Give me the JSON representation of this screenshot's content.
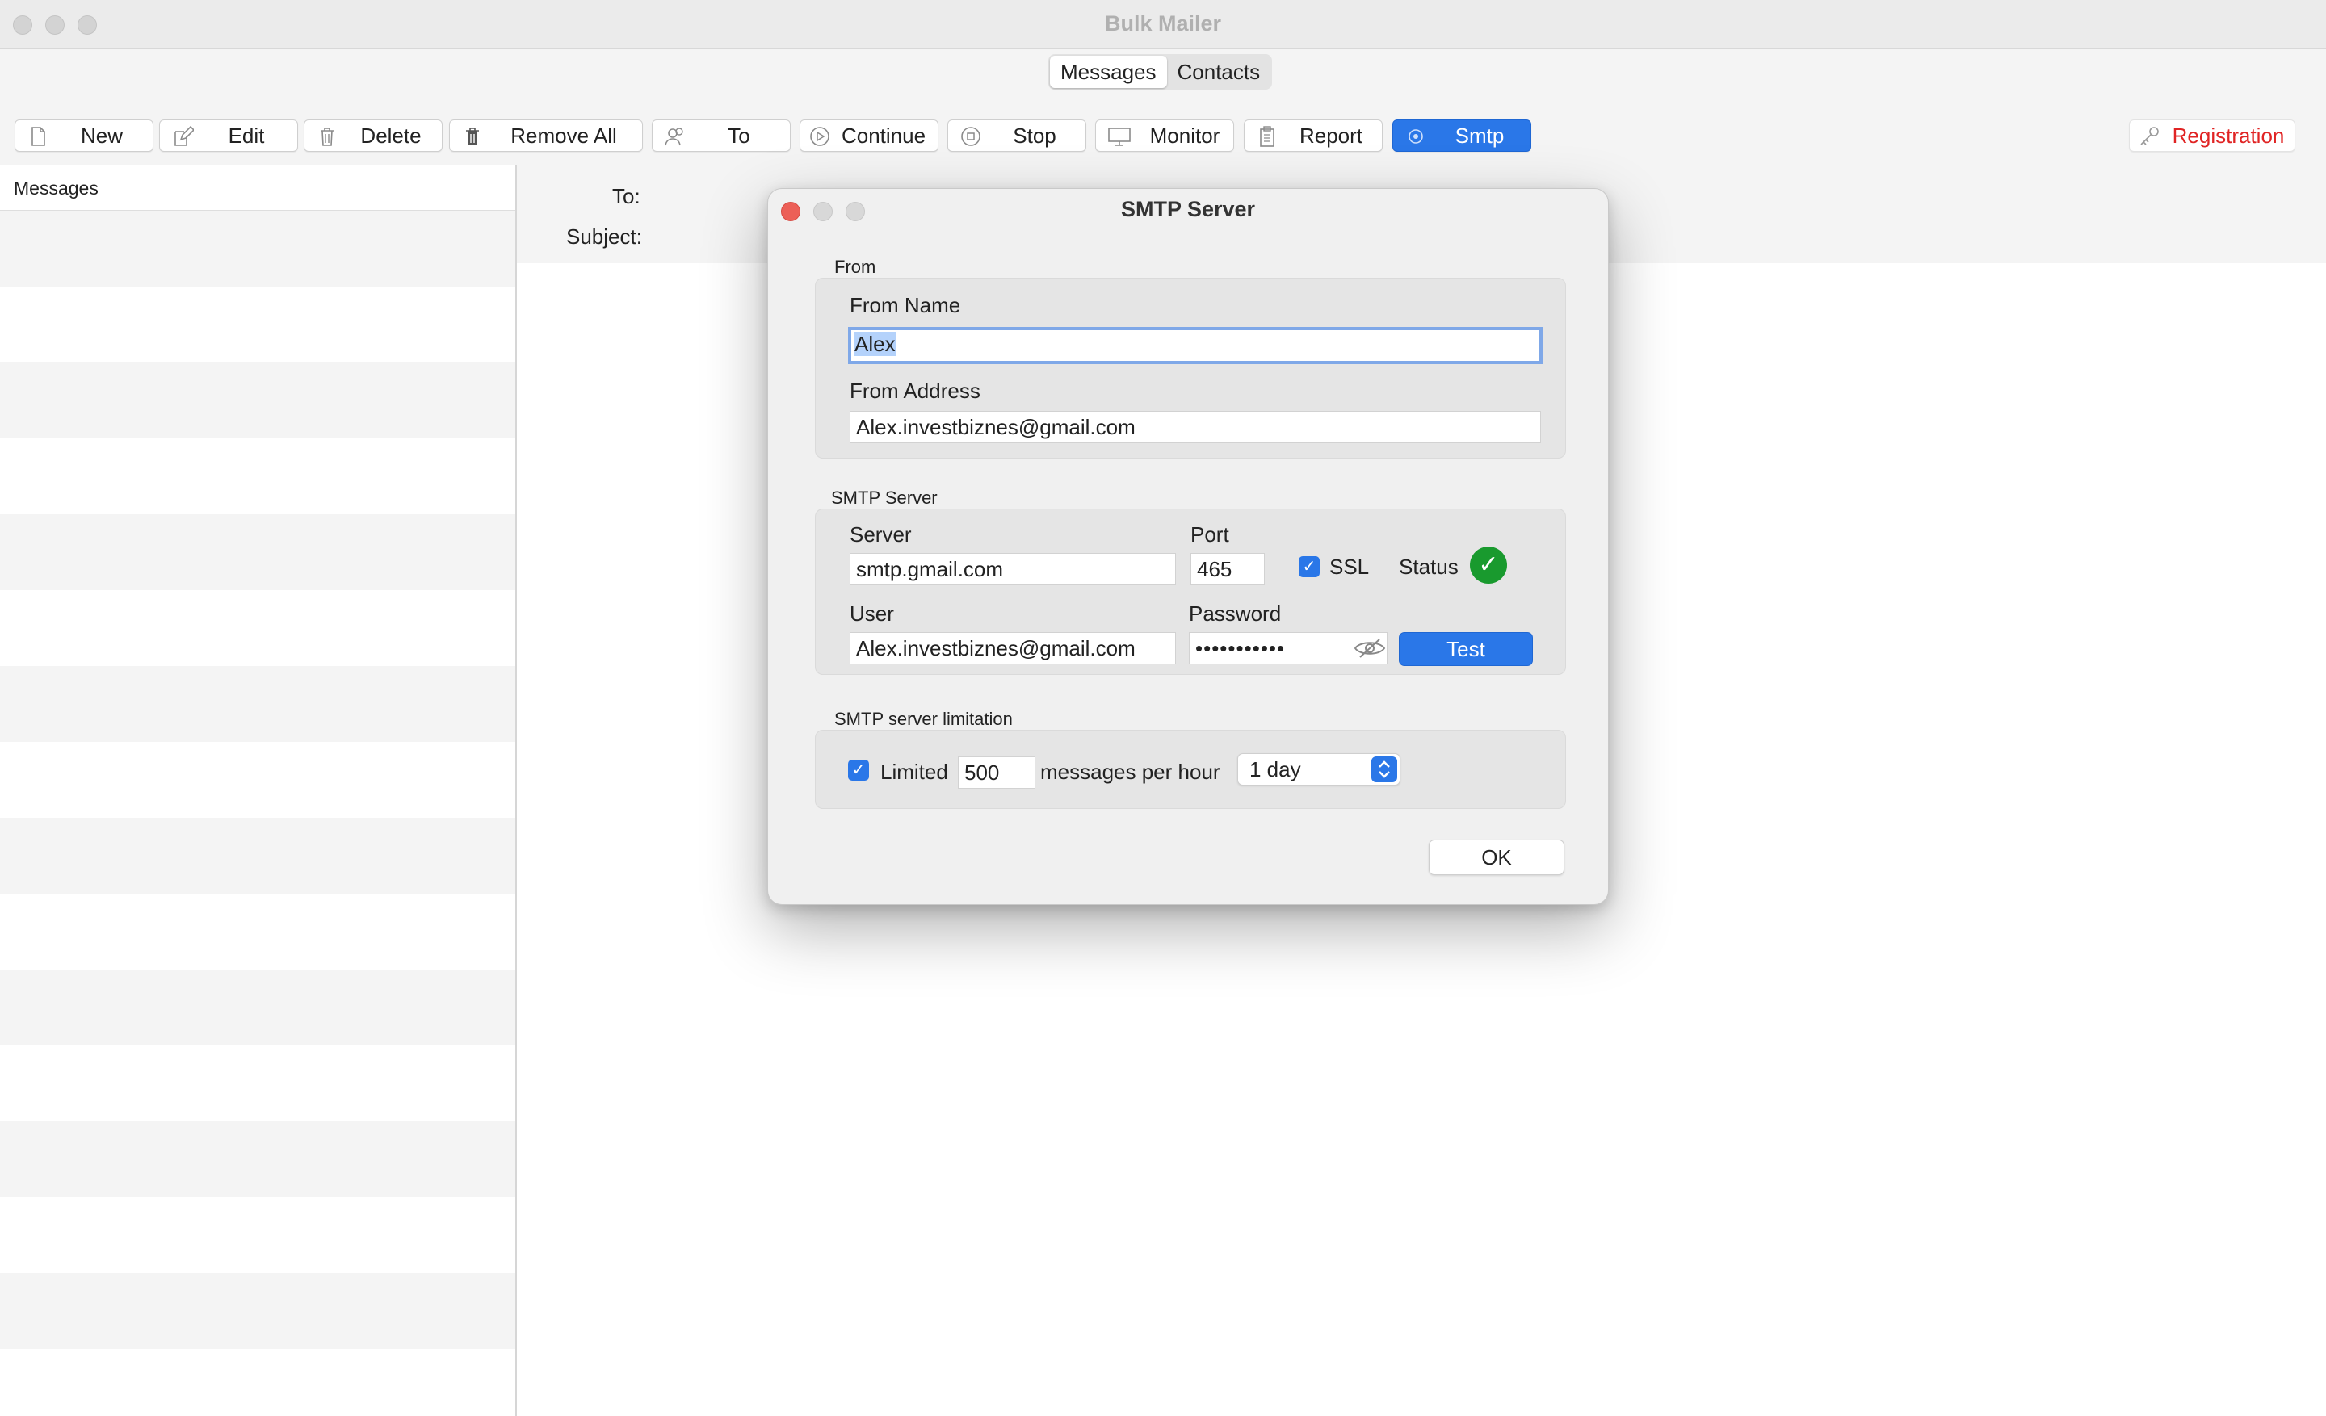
{
  "window": {
    "title": "Bulk Mailer"
  },
  "tabs": [
    {
      "label": "Messages",
      "active": true
    },
    {
      "label": "Contacts",
      "active": false
    }
  ],
  "toolbar": {
    "new": "New",
    "edit": "Edit",
    "delete": "Delete",
    "remove_all": "Remove All",
    "to": "To",
    "continue": "Continue",
    "stop": "Stop",
    "monitor": "Monitor",
    "report": "Report",
    "smtp": "Smtp",
    "registration": "Registration"
  },
  "sidebar": {
    "header": "Messages"
  },
  "editor": {
    "to_label": "To:",
    "subject_label": "Subject:"
  },
  "dialog": {
    "title": "SMTP Server",
    "from_section": "From",
    "from_name_label": "From Name",
    "from_name_value": "Alex",
    "from_address_label": "From Address",
    "from_address_value": "Alex.investbiznes@gmail.com",
    "smtp_section": "SMTP Server",
    "server_label": "Server",
    "server_value": "smtp.gmail.com",
    "port_label": "Port",
    "port_value": "465",
    "ssl_label": "SSL",
    "ssl_checked": true,
    "status_label": "Status",
    "status_ok": true,
    "user_label": "User",
    "user_value": "Alex.investbiznes@gmail.com",
    "password_label": "Password",
    "password_value": "•••••••••••",
    "test_button": "Test",
    "limit_section": "SMTP server limitation",
    "limited_label": "Limited",
    "limited_checked": true,
    "limit_value": "500",
    "limit_unit": "messages per hour",
    "period_value": "1 day",
    "ok_button": "OK"
  },
  "colors": {
    "accent": "#2a77e8",
    "registration": "#e02424",
    "status_ok": "#199a2e",
    "close_button": "#ec5f57"
  }
}
